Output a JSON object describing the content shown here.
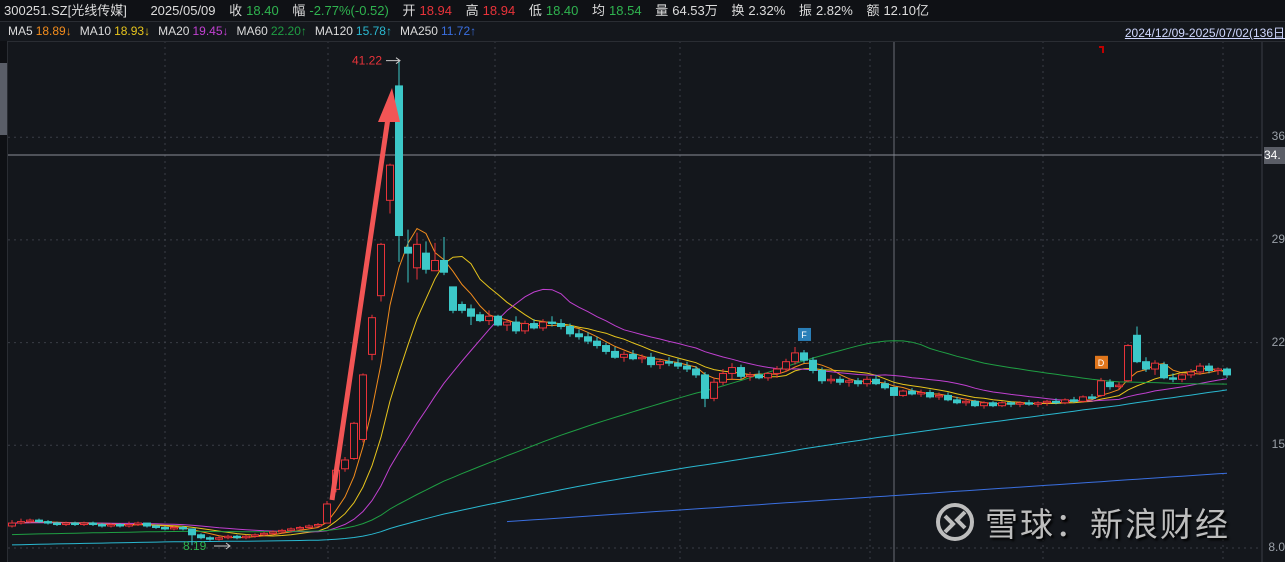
{
  "header": {
    "code": "300251.SZ[光线传媒]",
    "date": "2025/05/09",
    "close_label": "收",
    "close": "18.40",
    "change_label": "幅",
    "change": "-2.77%(-0.52)",
    "open_label": "开",
    "open": "18.94",
    "high_label": "高",
    "high": "18.94",
    "low_label": "低",
    "low": "18.40",
    "avg_label": "均",
    "avg": "18.54",
    "vol_label": "量",
    "vol": "64.53万",
    "turnover_label": "换",
    "turnover": "2.32%",
    "amp_label": "振",
    "amp": "2.82%",
    "amount_label": "额",
    "amount": "12.10亿"
  },
  "ma_legend": [
    {
      "name": "MA5",
      "value": "18.89↓",
      "color": "#f28c1c"
    },
    {
      "name": "MA10",
      "value": "18.93↓",
      "color": "#e6c41c"
    },
    {
      "name": "MA20",
      "value": "19.45↓",
      "color": "#c040d0"
    },
    {
      "name": "MA60",
      "value": "22.20↑",
      "color": "#1f9e43"
    },
    {
      "name": "MA120",
      "value": "15.78↑",
      "color": "#2ab8d0"
    },
    {
      "name": "MA250",
      "value": "11.72↑",
      "color": "#3a6fe0"
    }
  ],
  "range": "2024/12/09-2025/07/02(136日",
  "axis": {
    "labels": [
      "36",
      "29",
      "22",
      "15",
      "8.0"
    ],
    "ticks": [
      36,
      29,
      22,
      15,
      8
    ],
    "cursor_value": "34."
  },
  "annotations": {
    "high_label": "41.22",
    "low_label": "8.19",
    "markers": [
      {
        "text": "F",
        "index": 88,
        "color": "#2a7fb8"
      },
      {
        "text": "D",
        "index": 121,
        "color": "#e0761c"
      }
    ]
  },
  "watermark": "雪球：新浪财经",
  "colors": {
    "up": "#e8333a",
    "down": "#3cc8c8",
    "bg": "#14171c"
  },
  "chart_data": {
    "type": "candlestick",
    "ylim": [
      8,
      41.5
    ],
    "cursor_index": 98,
    "ma120_pre": 8.2,
    "ma250": {
      "start_index": 55,
      "start": 9.8,
      "end": 13.1
    },
    "candles": [
      [
        9.5,
        9.9,
        9.4,
        9.7
      ],
      [
        9.7,
        10.0,
        9.6,
        9.8
      ],
      [
        9.8,
        10.0,
        9.7,
        9.9
      ],
      [
        9.9,
        10.0,
        9.7,
        9.8
      ],
      [
        9.8,
        9.9,
        9.6,
        9.7
      ],
      [
        9.7,
        9.8,
        9.5,
        9.6
      ],
      [
        9.6,
        9.8,
        9.5,
        9.7
      ],
      [
        9.7,
        9.8,
        9.5,
        9.6
      ],
      [
        9.6,
        9.8,
        9.5,
        9.7
      ],
      [
        9.7,
        9.8,
        9.5,
        9.6
      ],
      [
        9.6,
        9.7,
        9.4,
        9.5
      ],
      [
        9.5,
        9.7,
        9.4,
        9.6
      ],
      [
        9.6,
        9.7,
        9.4,
        9.5
      ],
      [
        9.5,
        9.8,
        9.4,
        9.6
      ],
      [
        9.6,
        9.8,
        9.5,
        9.7
      ],
      [
        9.7,
        9.7,
        9.4,
        9.5
      ],
      [
        9.5,
        9.6,
        9.3,
        9.4
      ],
      [
        9.4,
        9.5,
        9.2,
        9.3
      ],
      [
        9.3,
        9.5,
        9.2,
        9.4
      ],
      [
        9.4,
        9.5,
        9.2,
        9.3
      ],
      [
        9.3,
        9.3,
        8.19,
        8.9
      ],
      [
        8.9,
        9.0,
        8.6,
        8.7
      ],
      [
        8.7,
        8.8,
        8.5,
        8.6
      ],
      [
        8.6,
        8.8,
        8.5,
        8.7
      ],
      [
        8.7,
        8.9,
        8.6,
        8.8
      ],
      [
        8.8,
        8.9,
        8.6,
        8.7
      ],
      [
        8.7,
        8.9,
        8.6,
        8.8
      ],
      [
        8.8,
        9.0,
        8.7,
        8.9
      ],
      [
        8.9,
        9.1,
        8.8,
        9.0
      ],
      [
        9.0,
        9.2,
        8.9,
        9.1
      ],
      [
        9.1,
        9.3,
        9.0,
        9.2
      ],
      [
        9.2,
        9.4,
        9.1,
        9.3
      ],
      [
        9.3,
        9.5,
        9.2,
        9.4
      ],
      [
        9.4,
        9.6,
        9.3,
        9.5
      ],
      [
        9.5,
        9.7,
        9.4,
        9.6
      ],
      [
        9.7,
        11.2,
        9.7,
        11.0
      ],
      [
        12.0,
        13.4,
        11.8,
        13.3
      ],
      [
        13.4,
        14.2,
        13.2,
        14.0
      ],
      [
        14.1,
        16.6,
        14.0,
        16.5
      ],
      [
        15.4,
        19.9,
        15.2,
        19.8
      ],
      [
        21.2,
        23.9,
        20.8,
        23.7
      ],
      [
        25.2,
        28.8,
        24.8,
        28.7
      ],
      [
        31.7,
        34.2,
        30.8,
        34.1
      ],
      [
        39.5,
        41.22,
        27.5,
        29.3
      ],
      [
        28.5,
        29.7,
        26.1,
        28.1
      ],
      [
        27.1,
        29.5,
        26.3,
        28.7
      ],
      [
        28.1,
        28.9,
        26.7,
        27.0
      ],
      [
        26.9,
        28.8,
        26.9,
        27.6
      ],
      [
        27.6,
        29.2,
        26.6,
        26.8
      ],
      [
        25.8,
        25.8,
        24.0,
        24.2
      ],
      [
        24.6,
        24.8,
        24.0,
        24.2
      ],
      [
        24.3,
        24.6,
        23.2,
        23.8
      ],
      [
        23.9,
        24.1,
        23.4,
        23.5
      ],
      [
        23.5,
        24.2,
        23.2,
        23.8
      ],
      [
        23.8,
        23.9,
        23.1,
        23.2
      ],
      [
        23.2,
        23.6,
        22.8,
        23.4
      ],
      [
        23.4,
        23.8,
        22.6,
        22.8
      ],
      [
        22.8,
        23.5,
        22.6,
        23.3
      ],
      [
        23.3,
        23.6,
        22.9,
        23.0
      ],
      [
        23.0,
        23.6,
        22.8,
        23.4
      ],
      [
        23.4,
        23.8,
        23.1,
        23.3
      ],
      [
        23.3,
        23.6,
        22.9,
        23.1
      ],
      [
        23.1,
        23.3,
        22.4,
        22.6
      ],
      [
        22.6,
        22.9,
        22.2,
        22.4
      ],
      [
        22.4,
        22.7,
        21.9,
        22.1
      ],
      [
        22.1,
        22.4,
        21.6,
        21.8
      ],
      [
        21.8,
        22.0,
        21.2,
        21.4
      ],
      [
        21.4,
        21.7,
        20.9,
        21.0
      ],
      [
        21.0,
        21.4,
        20.7,
        21.2
      ],
      [
        21.2,
        21.5,
        20.8,
        20.9
      ],
      [
        20.9,
        21.2,
        20.6,
        21.0
      ],
      [
        21.0,
        21.3,
        20.3,
        20.5
      ],
      [
        20.5,
        20.9,
        20.2,
        20.7
      ],
      [
        20.7,
        21.0,
        20.4,
        20.6
      ],
      [
        20.6,
        20.9,
        20.2,
        20.4
      ],
      [
        20.4,
        20.7,
        20.0,
        20.2
      ],
      [
        20.2,
        20.4,
        19.6,
        19.8
      ],
      [
        19.8,
        20.0,
        17.6,
        18.2
      ],
      [
        18.2,
        19.6,
        18.0,
        19.3
      ],
      [
        19.3,
        20.2,
        19.1,
        19.9
      ],
      [
        19.9,
        20.6,
        19.5,
        20.3
      ],
      [
        20.3,
        20.5,
        19.5,
        19.7
      ],
      [
        19.7,
        20.0,
        19.4,
        19.8
      ],
      [
        19.8,
        20.1,
        19.5,
        19.6
      ],
      [
        19.6,
        20.0,
        19.4,
        19.9
      ],
      [
        19.9,
        20.4,
        19.6,
        20.2
      ],
      [
        20.2,
        20.9,
        20.0,
        20.7
      ],
      [
        20.7,
        21.7,
        20.5,
        21.3
      ],
      [
        21.3,
        21.5,
        20.6,
        20.8
      ],
      [
        20.8,
        21.0,
        19.9,
        20.1
      ],
      [
        20.1,
        20.3,
        19.2,
        19.4
      ],
      [
        19.4,
        19.8,
        19.2,
        19.5
      ],
      [
        19.5,
        19.7,
        19.1,
        19.3
      ],
      [
        19.3,
        19.6,
        19.0,
        19.4
      ],
      [
        19.4,
        19.6,
        19.0,
        19.2
      ],
      [
        19.2,
        19.7,
        19.0,
        19.5
      ],
      [
        19.5,
        19.8,
        19.1,
        19.2
      ],
      [
        19.2,
        19.4,
        18.8,
        18.92
      ],
      [
        18.94,
        18.94,
        18.4,
        18.4
      ],
      [
        18.4,
        18.8,
        18.3,
        18.7
      ],
      [
        18.7,
        18.9,
        18.4,
        18.5
      ],
      [
        18.5,
        18.8,
        18.3,
        18.6
      ],
      [
        18.6,
        18.8,
        18.2,
        18.3
      ],
      [
        18.3,
        18.6,
        18.1,
        18.4
      ],
      [
        18.4,
        18.6,
        18.0,
        18.1
      ],
      [
        18.1,
        18.3,
        17.8,
        17.9
      ],
      [
        17.9,
        18.2,
        17.7,
        18.0
      ],
      [
        18.0,
        18.1,
        17.6,
        17.7
      ],
      [
        17.7,
        18.0,
        17.5,
        17.9
      ],
      [
        17.9,
        18.0,
        17.6,
        17.7
      ],
      [
        17.7,
        18.0,
        17.6,
        17.9
      ],
      [
        17.9,
        18.0,
        17.6,
        17.8
      ],
      [
        17.8,
        18.0,
        17.6,
        17.9
      ],
      [
        17.9,
        18.1,
        17.7,
        17.8
      ],
      [
        17.8,
        18.0,
        17.6,
        17.9
      ],
      [
        17.9,
        18.1,
        17.7,
        18.0
      ],
      [
        18.0,
        18.2,
        17.8,
        17.9
      ],
      [
        17.9,
        18.2,
        17.8,
        18.1
      ],
      [
        18.1,
        18.3,
        17.9,
        18.0
      ],
      [
        18.0,
        18.4,
        17.9,
        18.3
      ],
      [
        18.3,
        18.5,
        18.1,
        18.2
      ],
      [
        18.4,
        19.6,
        18.3,
        19.4
      ],
      [
        19.3,
        19.5,
        18.8,
        19.0
      ],
      [
        19.0,
        19.3,
        18.8,
        19.1
      ],
      [
        19.4,
        21.9,
        19.3,
        21.8
      ],
      [
        22.5,
        23.1,
        20.6,
        20.7
      ],
      [
        20.7,
        21.0,
        20.0,
        20.2
      ],
      [
        20.2,
        20.8,
        19.8,
        20.6
      ],
      [
        20.5,
        20.7,
        19.5,
        19.6
      ],
      [
        19.6,
        19.9,
        19.3,
        19.5
      ],
      [
        19.5,
        19.9,
        19.3,
        19.8
      ],
      [
        19.8,
        20.2,
        19.6,
        20.0
      ],
      [
        20.0,
        20.6,
        19.8,
        20.4
      ],
      [
        20.4,
        20.6,
        19.9,
        20.1
      ],
      [
        20.1,
        20.3,
        19.8,
        20.2
      ],
      [
        20.2,
        20.3,
        19.6,
        19.8
      ]
    ]
  }
}
